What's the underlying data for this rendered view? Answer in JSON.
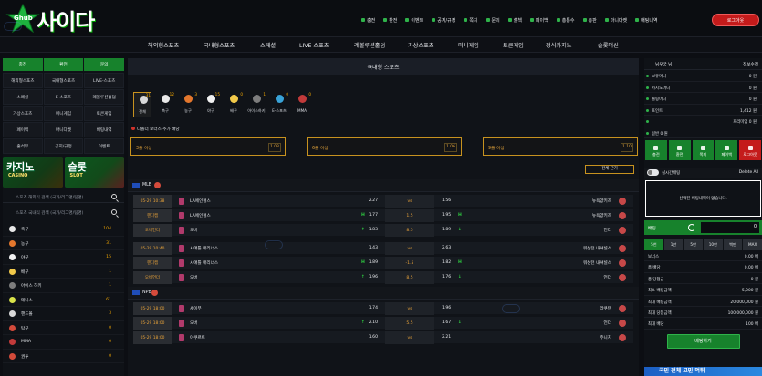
{
  "brand": {
    "logo_small": "Ghub",
    "logo_text": "사이다"
  },
  "top_nav": [
    {
      "label": "충전",
      "icon": "plus-icon"
    },
    {
      "label": "환전",
      "icon": "minus-icon"
    },
    {
      "label": "이벤트",
      "icon": "gift-icon"
    },
    {
      "label": "공지/규정",
      "icon": "notice-icon"
    },
    {
      "label": "쪽지",
      "icon": "mail-icon"
    },
    {
      "label": "문의",
      "icon": "question-icon"
    },
    {
      "label": "출첵",
      "icon": "check-icon"
    },
    {
      "label": "페이백",
      "icon": "payback-icon"
    },
    {
      "label": "총통수",
      "icon": "stats-icon"
    },
    {
      "label": "총판",
      "icon": "partner-icon"
    },
    {
      "label": "마니다켓",
      "icon": "market-icon"
    },
    {
      "label": "배팅내역",
      "icon": "history-icon"
    }
  ],
  "login_label": "로그아웃",
  "menu": [
    "해외형스포츠",
    "국내형스포츠",
    "스페셜",
    "LIVE 스포츠",
    "레볼루션홀덤",
    "가상스포츠",
    "미니게임",
    "토큰게임",
    "정식카지노",
    "슬롯머신"
  ],
  "left": {
    "buttons": [
      "충전",
      "환전",
      "문의"
    ],
    "grid": [
      "해외형스포츠",
      "국내형스포츠",
      "LIVE-스포츠",
      "스페셜",
      "E-스포츠",
      "레볼루션홀덤",
      "가상스포츠",
      "미니게임",
      "토큰게임",
      "페이백",
      "마니다켓",
      "배팅내역",
      "출석부",
      "공지/규정",
      "이벤트"
    ],
    "banners": [
      {
        "title": "카지노",
        "sub": "CASINO"
      },
      {
        "title": "슬롯",
        "sub": "SLOT"
      }
    ],
    "search_overseas": "스포츠 해외식 검색 (국가/리그명/팀명)",
    "search_domestic": "스포츠 국내식 검색 (국가/리그명/팀명)",
    "sports": [
      {
        "name": "축구",
        "count": "104",
        "color": "#e8e8e8"
      },
      {
        "name": "농구",
        "count": "31",
        "color": "#e3772d"
      },
      {
        "name": "야구",
        "count": "15",
        "color": "#f1f1f1"
      },
      {
        "name": "배구",
        "count": "1",
        "color": "#f1c94a"
      },
      {
        "name": "아이스 하키",
        "count": "1",
        "color": "#7d7d7d"
      },
      {
        "name": "테니스",
        "count": "61",
        "color": "#d9e34a"
      },
      {
        "name": "핸드볼",
        "count": "3",
        "color": "#d8d8d8"
      },
      {
        "name": "탁구",
        "count": "0",
        "color": "#d24a3a"
      },
      {
        "name": "MMA",
        "count": "0",
        "color": "#c23a3a"
      },
      {
        "name": "권투",
        "count": "0",
        "color": "#d24a3a"
      }
    ]
  },
  "center": {
    "title": "국내형 스포츠",
    "categories": [
      {
        "name": "전체",
        "count": "31",
        "color": "#d9d9d9",
        "active": true
      },
      {
        "name": "축구",
        "count": "12",
        "color": "#e8e8e8"
      },
      {
        "name": "농구",
        "count": "3",
        "color": "#e3772d"
      },
      {
        "name": "야구",
        "count": "15",
        "color": "#f1f1f1"
      },
      {
        "name": "배구",
        "count": "0",
        "color": "#f1c94a"
      },
      {
        "name": "아이스하키",
        "count": "1",
        "color": "#7d7d7d"
      },
      {
        "name": "E-스포츠",
        "count": "0",
        "color": "#39a3d8"
      },
      {
        "name": "MMA",
        "count": "0",
        "color": "#c23a3a"
      }
    ],
    "bonus_title": "다폴더 보너스 추가 배당",
    "bonuses": [
      {
        "label": "3폴 이상",
        "odds": "1.03"
      },
      {
        "label": "6폴 이상",
        "odds": "1.06"
      },
      {
        "label": "9폴 이상",
        "odds": "1.10"
      }
    ],
    "close_all": "전체 닫기",
    "leagues": [
      {
        "name": "MLB",
        "rows": [
          {
            "time": "05-29 10:38",
            "home": "LA에인절스",
            "hodds": "2.27",
            "hmark": "",
            "mid": "vs",
            "aodds": "1.56",
            "amark": "",
            "away": "뉴욕양키즈"
          },
          {
            "time": "핸디캡",
            "home": "LA에인절스",
            "hodds": "1.77",
            "hmark": "H",
            "mid": "1.5",
            "aodds": "1.95",
            "amark": "H",
            "away": "뉴욕양키즈"
          },
          {
            "time": "오버언더",
            "home": "오버",
            "hodds": "1.83",
            "hmark": "↑",
            "mid": "8.5",
            "aodds": "1.89",
            "amark": "↓",
            "away": "언더"
          }
        ]
      },
      {
        "name": "",
        "rows": [
          {
            "time": "05-29 10:40",
            "home": "시애틀 매리너스",
            "hodds": "1.43",
            "hmark": "",
            "mid": "vs",
            "aodds": "2.63",
            "amark": "",
            "away": "워싱턴 내셔널스"
          },
          {
            "time": "핸디캡",
            "home": "시애틀 매리너스",
            "hodds": "1.89",
            "hmark": "H",
            "mid": "-1.5",
            "aodds": "1.82",
            "amark": "H",
            "away": "워싱턴 내셔널스"
          },
          {
            "time": "오버언더",
            "home": "오버",
            "hodds": "1.96",
            "hmark": "↑",
            "mid": "8.5",
            "aodds": "1.76",
            "amark": "↓",
            "away": "언더"
          }
        ]
      },
      {
        "name": "NPB",
        "rows": [
          {
            "time": "05-29 18:00",
            "home": "세이부",
            "hodds": "1.74",
            "hmark": "",
            "mid": "vs",
            "aodds": "1.96",
            "amark": "",
            "away": "라쿠텐"
          },
          {
            "time": "05-29 18:00",
            "home": "오버",
            "hodds": "2.10",
            "hmark": "↑",
            "mid": "5.5",
            "aodds": "1.67",
            "amark": "↓",
            "away": "언더"
          },
          {
            "time": "05-29 18:00",
            "home": "야쿠르트",
            "hodds": "1.60",
            "hmark": "",
            "mid": "vs",
            "aodds": "2.21",
            "amark": "",
            "away": "주니치"
          }
        ]
      }
    ]
  },
  "right": {
    "user": "님우궁 님",
    "info_label": "정보수정",
    "info": [
      {
        "label": "보유머니",
        "value": "0 원"
      },
      {
        "label": "카지노머니",
        "value": "0 원"
      },
      {
        "label": "콜링머니",
        "value": "0 원"
      },
      {
        "label": "포인트",
        "value": "1,412 원"
      },
      {
        "label": "",
        "value": "프리미엄 0 원"
      },
      {
        "label": "일반 0 원",
        "value": ""
      }
    ],
    "buttons": [
      "충전",
      "환전",
      "쪽지",
      "페이백",
      "로그아웃"
    ],
    "realtime_label": "실시간배팅",
    "delete_all": "Delete All",
    "empty_msg": "선택된 배팅내역이 없습니다.",
    "bet_label": "배팅",
    "bet_value": "0",
    "chips": [
      "5천",
      "1만",
      "5만",
      "10만",
      "백만",
      "MAX"
    ],
    "stats": [
      {
        "label": "보너스",
        "value": "0.00 배"
      },
      {
        "label": "총 배당",
        "value": "0.00 배"
      },
      {
        "label": "총 당첨금",
        "value": "0 원"
      },
      {
        "label": "최소 배팅금액",
        "value": "5,000 원"
      },
      {
        "label": "최대 배팅금액",
        "value": "20,000,000 원"
      },
      {
        "label": "최대 당첨금액",
        "value": "100,000,000 원"
      },
      {
        "label": "최대 배당",
        "value": "100 배"
      }
    ],
    "bet_button": "배팅하기",
    "bottom_banner": "국민 전체 고민 먹튀"
  }
}
